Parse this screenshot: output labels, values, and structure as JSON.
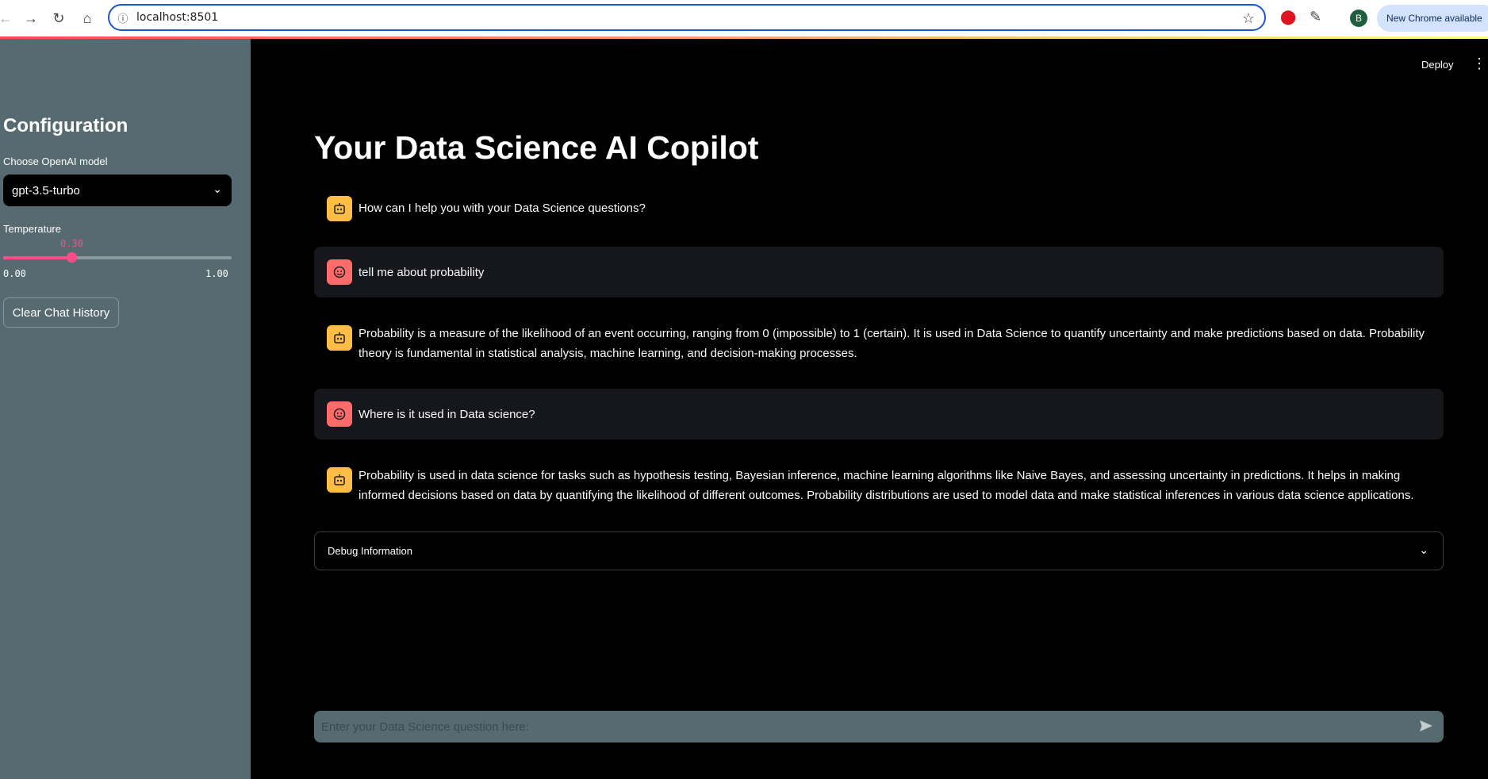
{
  "browser": {
    "url": "localhost:8501",
    "update_label": "New Chrome available",
    "profile_initial": "B"
  },
  "header": {
    "deploy_label": "Deploy"
  },
  "sidebar": {
    "title": "Configuration",
    "model_label": "Choose OpenAI model",
    "model_value": "gpt-3.5-turbo",
    "temperature_label": "Temperature",
    "temperature_value": "0.30",
    "temperature_fraction": 0.3,
    "temperature_min": "0.00",
    "temperature_max": "1.00",
    "clear_button": "Clear Chat History"
  },
  "main": {
    "title": "Your Data Science AI Copilot",
    "messages": [
      {
        "role": "assistant",
        "text": "How can I help you with your Data Science questions?"
      },
      {
        "role": "user",
        "text": "tell me about probability"
      },
      {
        "role": "assistant",
        "text": "Probability is a measure of the likelihood of an event occurring, ranging from 0 (impossible) to 1 (certain). It is used in Data Science to quantify uncertainty and make predictions based on data. Probability theory is fundamental in statistical analysis, machine learning, and decision-making processes."
      },
      {
        "role": "user",
        "text": "Where is it used in Data science?"
      },
      {
        "role": "assistant",
        "text": "Probability is used in data science for tasks such as hypothesis testing, Bayesian inference, machine learning algorithms like Naive Bayes, and assessing uncertainty in predictions. It helps in making informed decisions based on data by quantifying the likelihood of different outcomes. Probability distributions are used to model data and make statistical inferences in various data science applications."
      }
    ],
    "debug_label": "Debug Information",
    "input_placeholder": "Enter your Data Science question here:"
  }
}
